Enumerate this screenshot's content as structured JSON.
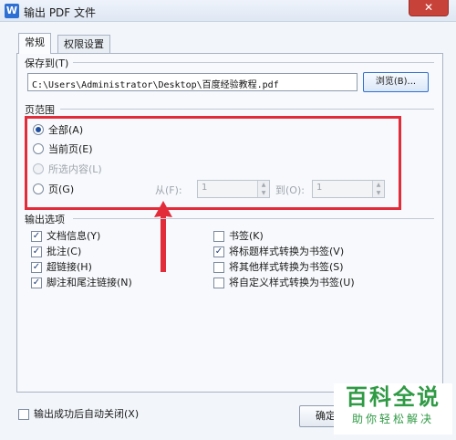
{
  "window": {
    "icon_letter": "W",
    "title": "输出 PDF 文件",
    "close_glyph": "✕"
  },
  "tabs": [
    {
      "label": "常规"
    },
    {
      "label": "权限设置"
    }
  ],
  "save_to": {
    "label": "保存到(T)",
    "path": "C:\\Users\\Administrator\\Desktop\\百度经验教程.pdf",
    "browse_label": "浏览(B)..."
  },
  "page_range": {
    "label": "页范围",
    "options": [
      {
        "label": "全部(A)"
      },
      {
        "label": "当前页(E)"
      },
      {
        "label": "所选内容(L)"
      },
      {
        "label": "页(G)"
      }
    ],
    "from_label": "从(F):",
    "from_value": "1",
    "to_label": "到(O):",
    "to_value": "1"
  },
  "output_options": {
    "label": "输出选项",
    "left": [
      {
        "label": "文档信息(Y)"
      },
      {
        "label": "批注(C)"
      },
      {
        "label": "超链接(H)"
      },
      {
        "label": "脚注和尾注链接(N)"
      }
    ],
    "right": [
      {
        "label": "书签(K)"
      },
      {
        "label": "将标题样式转换为书签(V)"
      },
      {
        "label": "将其他样式转换为书签(S)"
      },
      {
        "label": "将自定义样式转换为书签(U)"
      }
    ]
  },
  "footer": {
    "auto_close_label": "输出成功后自动关闭(X)",
    "ok_label": "确定"
  },
  "watermark": {
    "title": "百科全说",
    "subtitle": "助你轻松解决"
  },
  "check_glyph": "✓",
  "colors": {
    "highlight": "#e32c3a",
    "accent": "#2f6fcf",
    "watermark": "#2f9a44"
  }
}
